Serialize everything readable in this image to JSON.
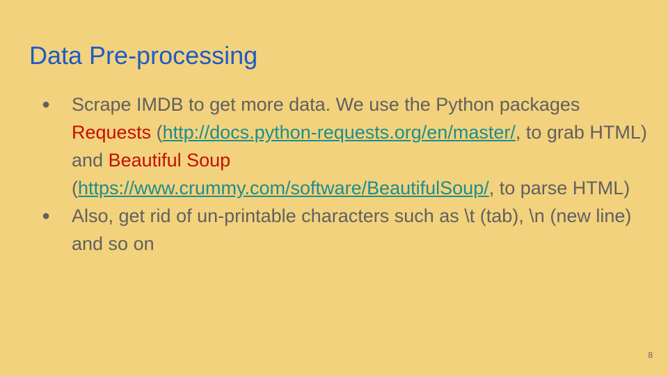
{
  "slide": {
    "title": "Data Pre-processing",
    "bullet_icon": "●",
    "bullets": [
      {
        "part1": "Scrape IMDB to get more data. We use the Python packages ",
        "requests_label": "Requests",
        "part2": " (",
        "requests_url": "http://docs.python-requests.org/en/master/",
        "part3": ", to grab HTML) and ",
        "bs_label": "Beautiful Soup",
        "part4": " (",
        "bs_url": "https://www.crummy.com/software/BeautifulSoup/",
        "part5": ", to parse HTML)"
      },
      {
        "text": "Also, get rid of un-printable characters such as \\t (tab), \\n (new line) and so on"
      }
    ],
    "page_number": "8"
  },
  "colors": {
    "background": "#f3d27d",
    "title": "#1c5cc5",
    "body_text": "#606060",
    "highlight": "#c50e06",
    "link": "#1d8d8c"
  }
}
